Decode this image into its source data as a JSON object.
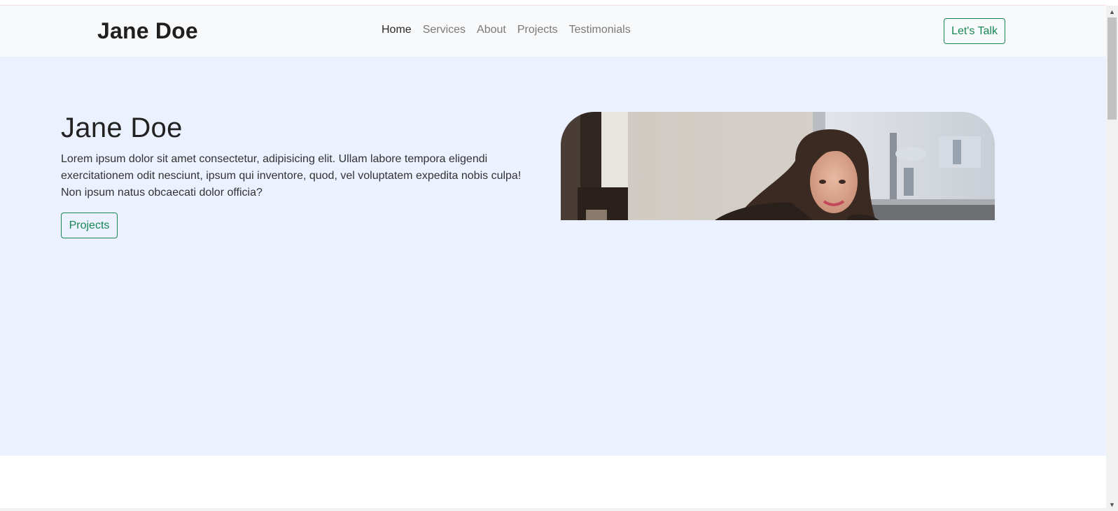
{
  "navbar": {
    "brand": "Jane Doe",
    "links": [
      {
        "label": "Home",
        "active": true
      },
      {
        "label": "Services",
        "active": false
      },
      {
        "label": "About",
        "active": false
      },
      {
        "label": "Projects",
        "active": false
      },
      {
        "label": "Testimonials",
        "active": false
      }
    ],
    "cta_label": "Let's Talk"
  },
  "hero": {
    "title": "Jane Doe",
    "text": "Lorem ipsum dolor sit amet consectetur, adipisicing elit. Ullam labore tempora eligendi exercitationem odit nesciunt, ipsum qui inventore, quod, vel voluptatem expedita nobis culpa! Non ipsum natus obcaecati dolor officia?",
    "button_label": "Projects",
    "photo": "smiling-woman-in-cafe-photo"
  },
  "colors": {
    "accent": "#198754",
    "navbar_bg": "#f8f9fa",
    "hero_bg": "#ebf1ff"
  },
  "icons": {
    "scroll_up": "arrow-up-icon",
    "scroll_down": "arrow-down-icon"
  }
}
